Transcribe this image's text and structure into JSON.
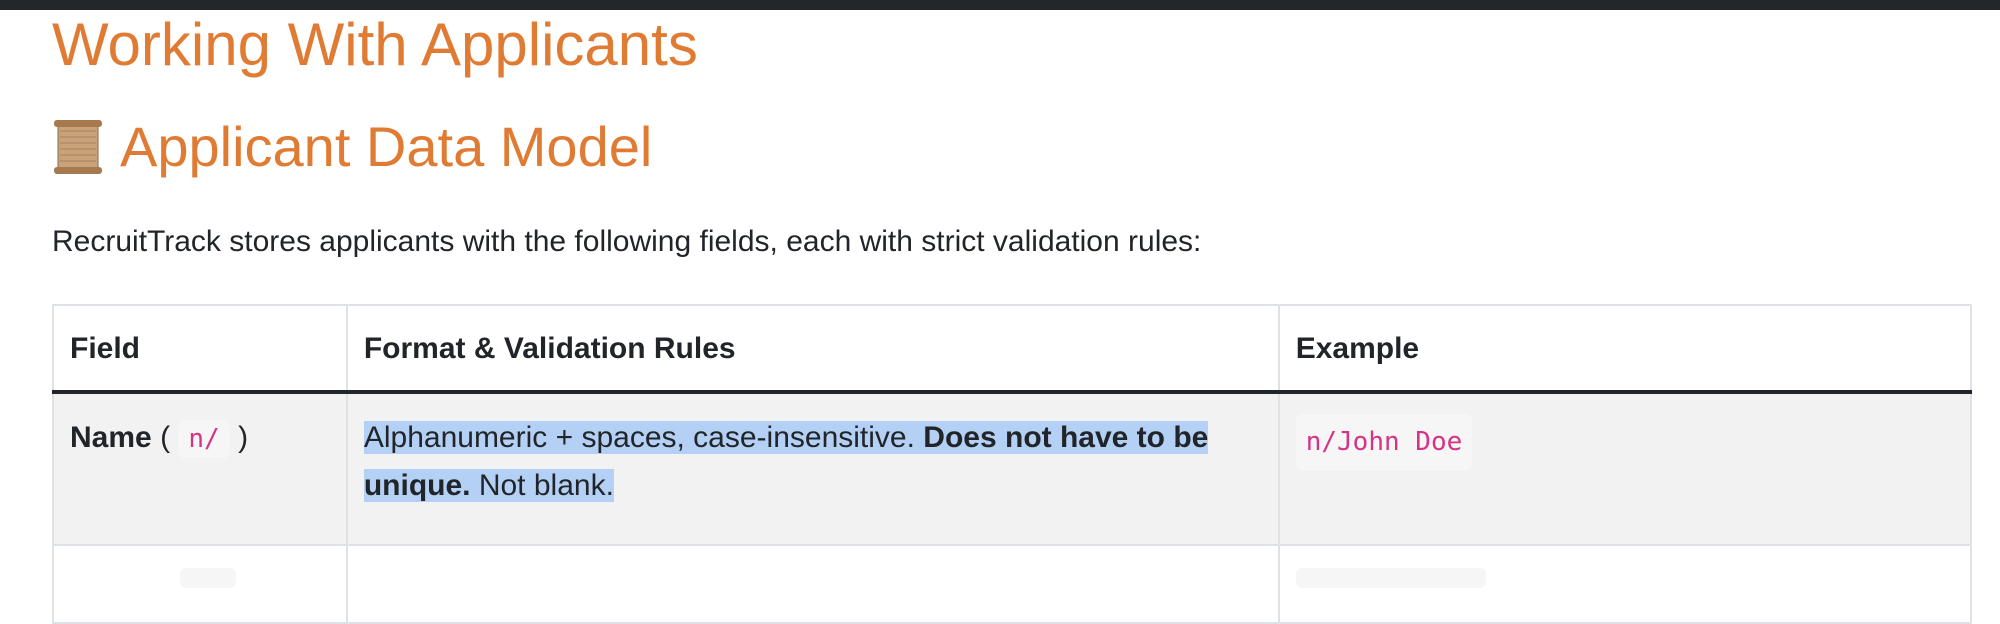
{
  "page": {
    "title": "Working With Applicants",
    "section_title": "Applicant Data Model",
    "section_icon": "scroll-icon",
    "intro": "RecruitTrack stores applicants with the following fields, each with strict validation rules:"
  },
  "table": {
    "headers": [
      "Field",
      "Format & Validation Rules",
      "Example"
    ],
    "rows": [
      {
        "field_label": "Name",
        "field_open": "(",
        "field_prefix": "n/",
        "field_close": ")",
        "rule_plain_1": "Alphanumeric + spaces, case-insensitive. ",
        "rule_bold": "Does not have to be unique.",
        "rule_plain_2": " Not blank.",
        "example": "n/John Doe"
      }
    ]
  },
  "colors": {
    "heading": "#e07b33",
    "code_text": "#d63384",
    "code_bg": "#f6f6f6",
    "selection": "#b4d0f4",
    "row_bg": "#f2f2f2",
    "top_bar": "#23272b"
  }
}
